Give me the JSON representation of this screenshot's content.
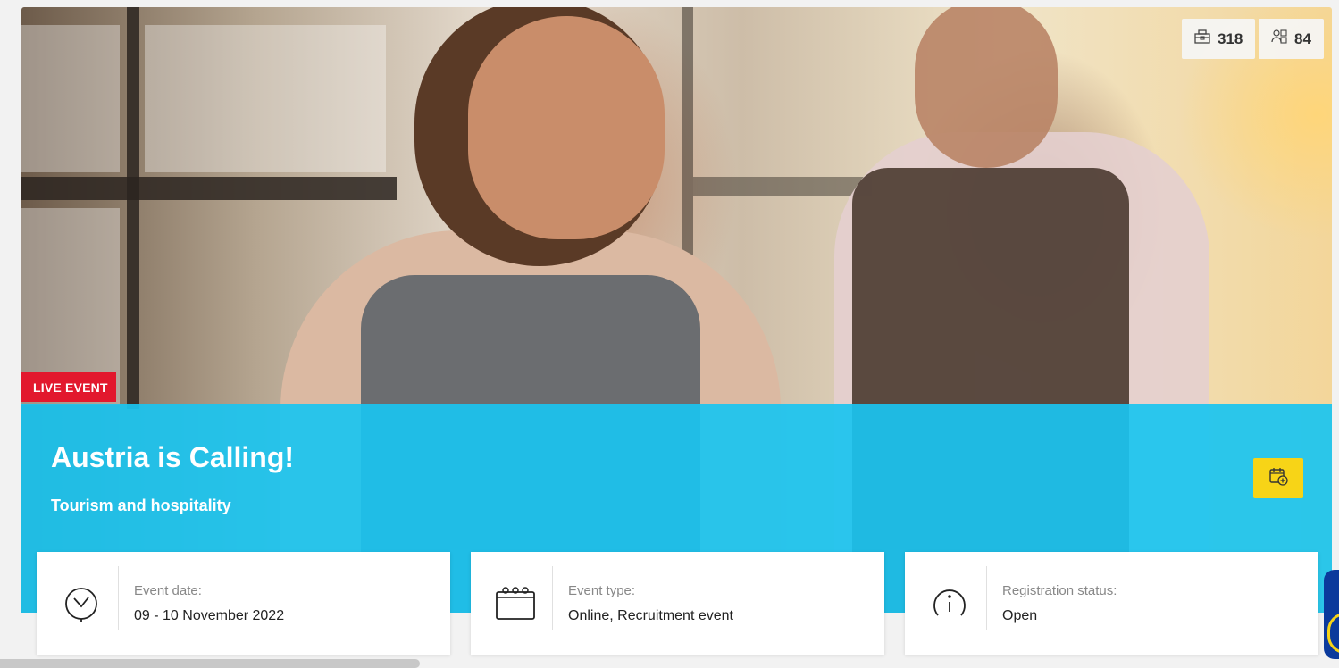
{
  "hero": {
    "badge": "LIVE EVENT",
    "title": "Austria is Calling!",
    "subtitle": "Tourism and hospitality"
  },
  "stats": [
    {
      "icon": "building-icon",
      "value": "318"
    },
    {
      "icon": "users-icon",
      "value": "84"
    }
  ],
  "calendar_button_icon": "calendar-plus-icon",
  "info_cards": [
    {
      "icon": "clock-icon",
      "label": "Event date:",
      "value": "09 - 10 November 2022"
    },
    {
      "icon": "calendar-icon",
      "label": "Event type:",
      "value": "Online, Recruitment event"
    },
    {
      "icon": "info-icon",
      "label": "Registration status:",
      "value": "Open"
    }
  ],
  "colors": {
    "overlay": "#1ac4f0",
    "badge": "#e2182d",
    "calendar_button": "#f7d417"
  }
}
